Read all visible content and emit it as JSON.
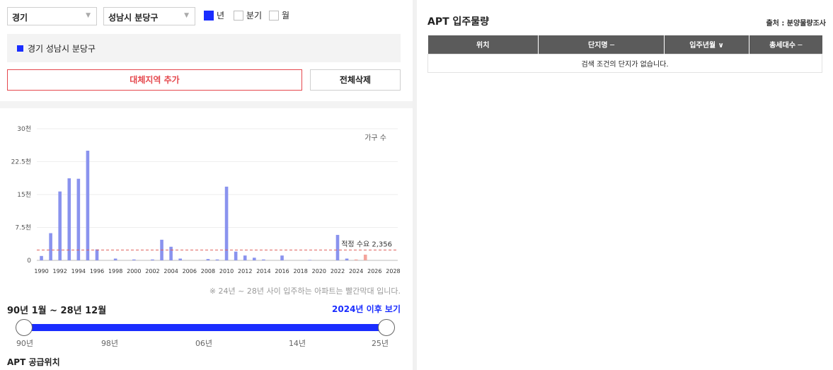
{
  "filters": {
    "province": "경기",
    "district": "성남시 분당구",
    "periods": [
      {
        "label": "년",
        "checked": true
      },
      {
        "label": "분기",
        "checked": false
      },
      {
        "label": "월",
        "checked": false
      }
    ]
  },
  "selected_region": "경기 성남시 분당구",
  "buttons": {
    "add_region": "대체지역 추가",
    "delete_all": "전체삭제"
  },
  "chart_data": {
    "type": "bar",
    "legend": "가구 수",
    "y_ticks": [
      "30천",
      "22.5천",
      "15천",
      "7.5천",
      "0"
    ],
    "ylim": [
      0,
      30000
    ],
    "x_tick_labels": [
      "1990",
      "1992",
      "1994",
      "1996",
      "1998",
      "2000",
      "2002",
      "2004",
      "2006",
      "2008",
      "2010",
      "2012",
      "2014",
      "2016",
      "2018",
      "2020",
      "2022",
      "2024",
      "2026",
      "2028"
    ],
    "categories": [
      1990,
      1991,
      1992,
      1993,
      1994,
      1995,
      1996,
      1997,
      1998,
      1999,
      2000,
      2001,
      2002,
      2003,
      2004,
      2005,
      2006,
      2007,
      2008,
      2009,
      2010,
      2011,
      2012,
      2013,
      2014,
      2015,
      2016,
      2017,
      2018,
      2019,
      2020,
      2021,
      2022,
      2023,
      2024,
      2025,
      2026,
      2027,
      2028
    ],
    "values": [
      1000,
      6200,
      15700,
      18700,
      18600,
      25000,
      2500,
      0,
      400,
      0,
      200,
      0,
      200,
      4700,
      3100,
      400,
      0,
      0,
      300,
      200,
      16800,
      2000,
      1100,
      600,
      200,
      0,
      1100,
      0,
      0,
      100,
      0,
      0,
      5800,
      400,
      200,
      1300,
      0,
      0,
      0
    ],
    "future_from": 2024,
    "reference_line": {
      "value": 2356,
      "label": "적정 수요 2,356"
    },
    "colors": {
      "bar": "#8a93ee",
      "future_bar": "#f4a49c",
      "reference": "#e0605c"
    }
  },
  "chart_note": "※ 24년 ~ 28년 사이 입주하는 아파트는 빨간막대 입니다.",
  "range_label": "90년 1월 ~ 28년 12월",
  "after_link": "2024년 이후 보기",
  "slider": {
    "ticks": [
      "90년",
      "98년",
      "06년",
      "14년",
      "25년"
    ],
    "start_fraction": 0,
    "end_fraction": 1
  },
  "supply_title": "APT 공급위치",
  "right_panel": {
    "title": "APT 입주물량",
    "source": "출처 : 분양물량조사",
    "columns": [
      "위치",
      "단지명 ─",
      "입주년월 ∨",
      "총세대수 ─"
    ],
    "empty_message": "검색 조건의 단지가 없습니다."
  }
}
